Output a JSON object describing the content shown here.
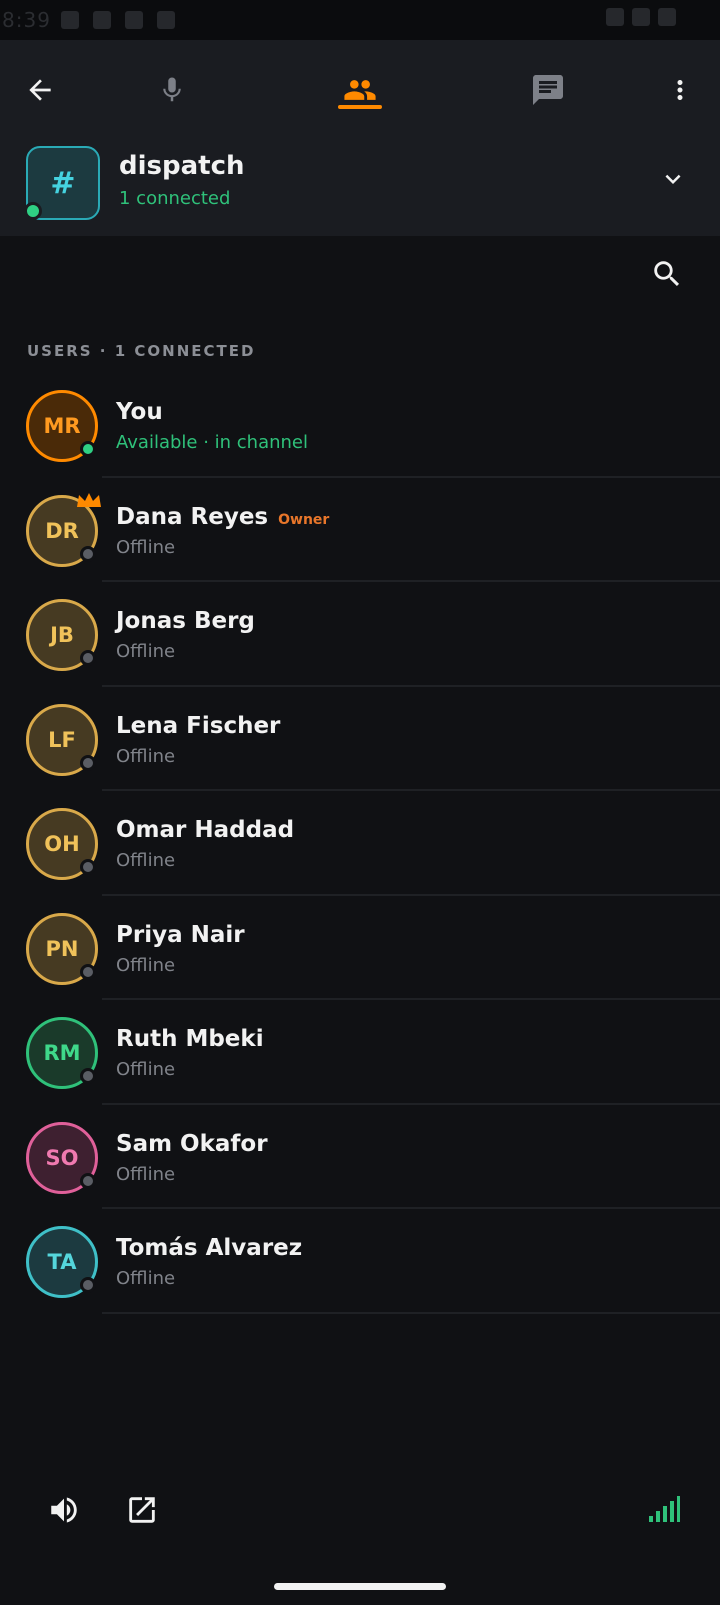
{
  "status_bar": {
    "time": "8:39"
  },
  "nav": {
    "tabs": [
      {
        "icon": "mic-icon",
        "active": false
      },
      {
        "icon": "users-icon",
        "active": true
      },
      {
        "icon": "chat-icon",
        "active": false
      }
    ],
    "accent": "#ff8a00"
  },
  "channel": {
    "symbol": "#",
    "name": "dispatch",
    "subtitle": "1 connected",
    "status_color": "#2fd084"
  },
  "section": {
    "label": "USERS · 1 CONNECTED"
  },
  "users": [
    {
      "initials": "MR",
      "name": "You",
      "badge": "",
      "status": "Available · in channel",
      "online": true,
      "color": "#ff8a00",
      "bg": "#4a2a08",
      "text": "#ff9a20"
    },
    {
      "initials": "DR",
      "name": "Dana Reyes",
      "badge": "Owner",
      "status": "Offline",
      "online": false,
      "color": "#d9a94a",
      "bg": "#463a22",
      "text": "#f0c25a",
      "crown": true
    },
    {
      "initials": "JB",
      "name": "Jonas Berg",
      "badge": "",
      "status": "Offline",
      "online": false,
      "color": "#d9a94a",
      "bg": "#463a22",
      "text": "#f0c25a"
    },
    {
      "initials": "LF",
      "name": "Lena Fischer",
      "badge": "",
      "status": "Offline",
      "online": false,
      "color": "#d9a94a",
      "bg": "#463a22",
      "text": "#f0c25a"
    },
    {
      "initials": "OH",
      "name": "Omar Haddad",
      "badge": "",
      "status": "Offline",
      "online": false,
      "color": "#d9a94a",
      "bg": "#463a22",
      "text": "#f0c25a"
    },
    {
      "initials": "PN",
      "name": "Priya Nair",
      "badge": "",
      "status": "Offline",
      "online": false,
      "color": "#d9a94a",
      "bg": "#463a22",
      "text": "#f0c25a"
    },
    {
      "initials": "RM",
      "name": "Ruth Mbeki",
      "badge": "",
      "status": "Offline",
      "online": false,
      "color": "#2fc17a",
      "bg": "#1a3a2a",
      "text": "#3fd88a"
    },
    {
      "initials": "SO",
      "name": "Sam Okafor",
      "badge": "",
      "status": "Offline",
      "online": false,
      "color": "#e0609a",
      "bg": "#3e2030",
      "text": "#f07ab0"
    },
    {
      "initials": "TA",
      "name": "Tomás Alvarez",
      "badge": "",
      "status": "Offline",
      "online": false,
      "color": "#3fc0c8",
      "bg": "#1c3a40",
      "text": "#55d6dc"
    }
  ],
  "bottom_bar": {
    "icons": [
      "speaker-icon",
      "open-external-icon",
      "signal-icon"
    ],
    "signal_color": "#2fc17a"
  }
}
